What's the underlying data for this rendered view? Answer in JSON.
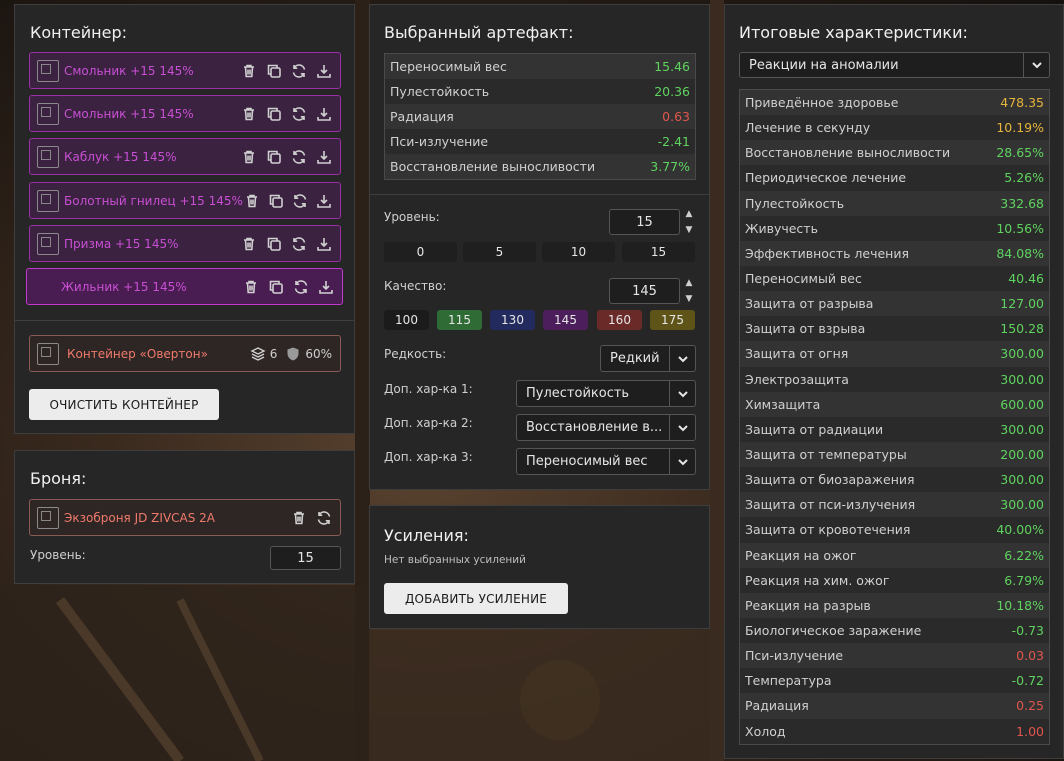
{
  "container": {
    "title": "Контейнер:",
    "artifacts": [
      {
        "name": "Смольник +15 145%"
      },
      {
        "name": "Смольник +15 145%"
      },
      {
        "name": "Каблук +15 145%"
      },
      {
        "name": "Болотный гнилец +15 145%"
      },
      {
        "name": "Призма +15 145%"
      },
      {
        "name": "Жильник +15 145%"
      }
    ],
    "box": {
      "name": "Контейнер «Овертон»",
      "slots": "6",
      "protection": "60%"
    },
    "clear_button": "Очистить контейнер"
  },
  "armor": {
    "title": "Броня:",
    "name": "Экзоброня JD ZIVCAS 2A",
    "level_label": "Уровень:",
    "level_value": "15"
  },
  "artifact": {
    "title": "Выбранный артефакт:",
    "stats": [
      {
        "name": "Переносимый вес",
        "value": "15.46",
        "color": "green"
      },
      {
        "name": "Пулестойкость",
        "value": "20.36",
        "color": "green"
      },
      {
        "name": "Радиация",
        "value": "0.63",
        "color": "red"
      },
      {
        "name": "Пси-излучение",
        "value": "-2.41",
        "color": "green"
      },
      {
        "name": "Восстановление выносливости",
        "value": "3.77%",
        "color": "green"
      }
    ],
    "level_label": "Уровень:",
    "level_value": "15",
    "level_presets": [
      "0",
      "5",
      "10",
      "15"
    ],
    "quality_label": "Качество:",
    "quality_value": "145",
    "quality_presets": [
      {
        "label": "100",
        "color": "#1b1b1b"
      },
      {
        "label": "115",
        "color": "#2e6b35"
      },
      {
        "label": "130",
        "color": "#232a5e"
      },
      {
        "label": "145",
        "color": "#4c1f5c"
      },
      {
        "label": "160",
        "color": "#6a2a28"
      },
      {
        "label": "175",
        "color": "#5f5418"
      }
    ],
    "rarity_label": "Редкость:",
    "rarity_value": "Редкий",
    "extra1_label": "Доп. хар-ка 1:",
    "extra1_value": "Пулестойкость",
    "extra2_label": "Доп. хар-ка 2:",
    "extra2_value": "Восстановление в...",
    "extra3_label": "Доп. хар-ка 3:",
    "extra3_value": "Переносимый вес"
  },
  "boosts": {
    "title": "Усиления:",
    "empty_text": "Нет выбранных усилений",
    "add_button": "Добавить усиление"
  },
  "final": {
    "title": "Итоговые характеристики:",
    "filter_value": "Реакции на аномалии",
    "stats": [
      {
        "name": "Приведённое здоровье",
        "value": "478.35",
        "color": "yellow"
      },
      {
        "name": "Лечение в секунду",
        "value": "10.19%",
        "color": "yellow"
      },
      {
        "name": "Восстановление выносливости",
        "value": "28.65%",
        "color": "green"
      },
      {
        "name": "Периодическое лечение",
        "value": "5.26%",
        "color": "green"
      },
      {
        "name": "Пулестойкость",
        "value": "332.68",
        "color": "green"
      },
      {
        "name": "Живучесть",
        "value": "10.56%",
        "color": "green"
      },
      {
        "name": "Эффективность лечения",
        "value": "84.08%",
        "color": "green"
      },
      {
        "name": "Переносимый вес",
        "value": "40.46",
        "color": "green"
      },
      {
        "name": "Защита от разрыва",
        "value": "127.00",
        "color": "green"
      },
      {
        "name": "Защита от взрыва",
        "value": "150.28",
        "color": "green"
      },
      {
        "name": "Защита от огня",
        "value": "300.00",
        "color": "green"
      },
      {
        "name": "Электрозащита",
        "value": "300.00",
        "color": "green"
      },
      {
        "name": "Химзащита",
        "value": "600.00",
        "color": "green"
      },
      {
        "name": "Защита от радиации",
        "value": "300.00",
        "color": "green"
      },
      {
        "name": "Защита от температуры",
        "value": "200.00",
        "color": "green"
      },
      {
        "name": "Защита от биозаражения",
        "value": "300.00",
        "color": "green"
      },
      {
        "name": "Защита от пси-излучения",
        "value": "300.00",
        "color": "green"
      },
      {
        "name": "Защита от кровотечения",
        "value": "40.00%",
        "color": "green"
      },
      {
        "name": "Реакция на ожог",
        "value": "6.22%",
        "color": "green"
      },
      {
        "name": "Реакция на хим. ожог",
        "value": "6.79%",
        "color": "green"
      },
      {
        "name": "Реакция на разрыв",
        "value": "10.18%",
        "color": "green"
      },
      {
        "name": "Биологическое заражение",
        "value": "-0.73",
        "color": "green"
      },
      {
        "name": "Пси-излучение",
        "value": "0.03",
        "color": "red"
      },
      {
        "name": "Температура",
        "value": "-0.72",
        "color": "green"
      },
      {
        "name": "Радиация",
        "value": "0.25",
        "color": "red"
      },
      {
        "name": "Холод",
        "value": "1.00",
        "color": "red"
      }
    ]
  },
  "colors": {
    "accent_purple": "#c94fd4",
    "accent_red": "#f07a6a",
    "positive": "#5fd35f",
    "negative": "#e0564e",
    "highlight": "#e6b43c"
  }
}
